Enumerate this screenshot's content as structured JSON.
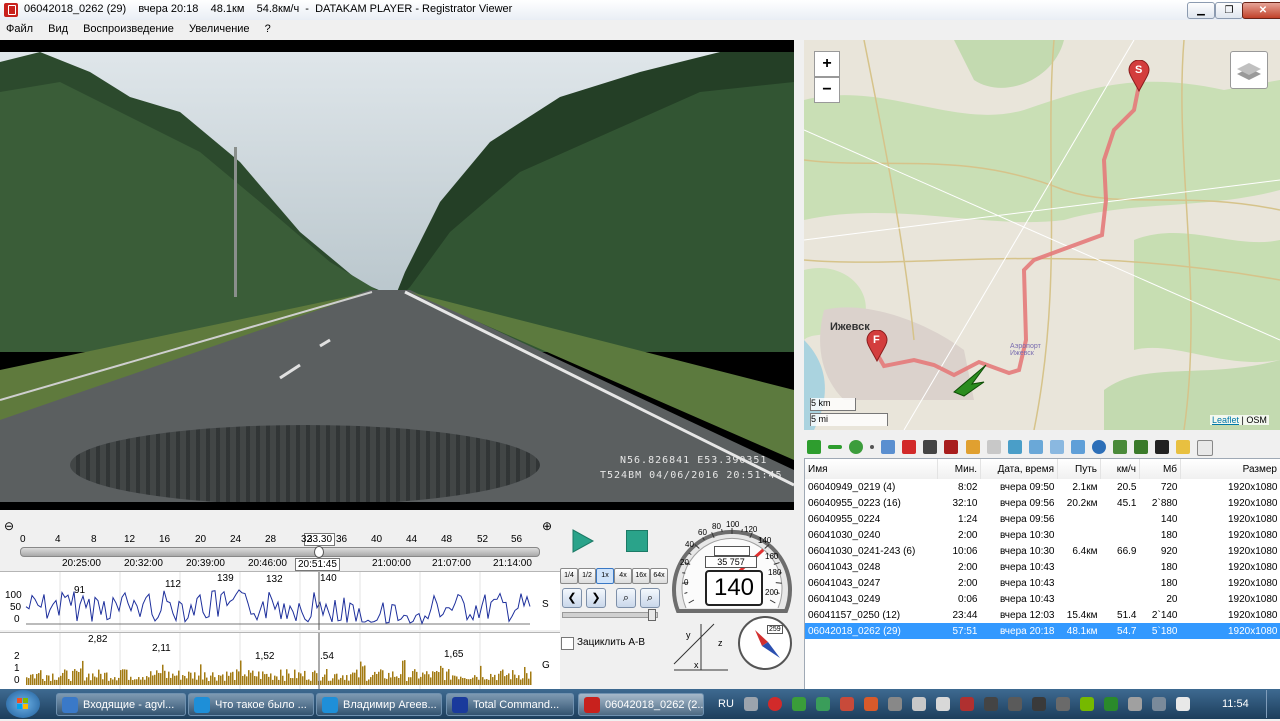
{
  "window": {
    "title": "06042018_0262 (29)    вчера 20:18    48.1км    54.8км/ч  -  DATAKAM PLAYER - Registrator Viewer",
    "min": "▁",
    "max": "❐",
    "close": "✕"
  },
  "menu": [
    "Файл",
    "Вид",
    "Воспроизведение",
    "Увеличение",
    "?"
  ],
  "video": {
    "coords": "N56.826841  E53.390351",
    "stamp": "T524BM 04/06/2016 20:51:45"
  },
  "timeline": {
    "minutes": [
      "0",
      "4",
      "8",
      "12",
      "16",
      "20",
      "24",
      "28",
      "32",
      "36",
      "40",
      "44",
      "48",
      "52",
      "56"
    ],
    "current_min": "33.30",
    "times": [
      "20:25:00",
      "20:32:00",
      "20:39:00",
      "20:46:00",
      "21:00:00",
      "21:07:00",
      "21:14:00"
    ],
    "current_time": "20:51:45",
    "speed_axis": [
      "100",
      "50",
      "0"
    ],
    "speed_label": "S",
    "speed_peaks": [
      "91",
      "112",
      "139",
      "132",
      "140"
    ],
    "g_axis": [
      "2",
      "1",
      "0"
    ],
    "g_label": "G",
    "g_peaks": [
      "2,82",
      "2,11",
      "1,52",
      ".54",
      "1,65"
    ]
  },
  "controls": {
    "speeds": [
      "1/4",
      "1/2",
      "1x",
      "4x",
      "16x",
      "64x"
    ],
    "active_speed": "1x",
    "ab_label": "Зациклить А-В"
  },
  "speedometer": {
    "odometer": "35 757",
    "value": "140",
    "scale": [
      "0",
      "20",
      "40",
      "60",
      "80",
      "100",
      "120",
      "140",
      "160",
      "180",
      "200"
    ],
    "current": 140
  },
  "compass": {
    "badge": "259",
    "axes": [
      "y",
      "z",
      "x"
    ]
  },
  "map": {
    "city": "Ижевск",
    "airport": "Аэропорт Ижевск",
    "start": "S",
    "finish": "F",
    "scale_km": "5 km",
    "scale_mi": "5 mi",
    "attribution_link": "Leaflet",
    "attribution_sep": " | ",
    "attribution_osm": "OSM"
  },
  "table": {
    "headers": [
      "Имя",
      "Мин.",
      "Дата, время",
      "Путь",
      "км/ч",
      "Мб",
      "Размер"
    ],
    "rows": [
      [
        "06040949_0219 (4)",
        "8:02",
        "вчера 09:50",
        "2.1км",
        "20.5",
        "720",
        "1920x1080"
      ],
      [
        "06040955_0223 (16)",
        "32:10",
        "вчера 09:56",
        "20.2км",
        "45.1",
        "2`880",
        "1920x1080"
      ],
      [
        "06040955_0224",
        "1:24",
        "вчера 09:56",
        "",
        "",
        "140",
        "1920x1080"
      ],
      [
        "06041030_0240",
        "2:00",
        "вчера 10:30",
        "",
        "",
        "180",
        "1920x1080"
      ],
      [
        "06041030_0241-243 (6)",
        "10:06",
        "вчера 10:30",
        "6.4км",
        "66.9",
        "920",
        "1920x1080"
      ],
      [
        "06041043_0248",
        "2:00",
        "вчера 10:43",
        "",
        "",
        "180",
        "1920x1080"
      ],
      [
        "06041043_0247",
        "2:00",
        "вчера 10:43",
        "",
        "",
        "180",
        "1920x1080"
      ],
      [
        "06041043_0249",
        "0:06",
        "вчера 10:43",
        "",
        "",
        "20",
        "1920x1080"
      ],
      [
        "06041157_0250 (12)",
        "23:44",
        "вчера 12:03",
        "15.4км",
        "51.4",
        "2`140",
        "1920x1080"
      ],
      [
        "06042018_0262 (29)",
        "57:51",
        "вчера 20:18",
        "48.1км",
        "54.7",
        "5`180",
        "1920x1080"
      ]
    ],
    "selected": 9
  },
  "taskbar": {
    "tasks": [
      "Входящие - agvl...",
      "Что такое было ...",
      "Владимир Агеев...",
      "Total Command...",
      "06042018_0262 (2..."
    ],
    "lang": "RU",
    "clock": "11:54"
  }
}
